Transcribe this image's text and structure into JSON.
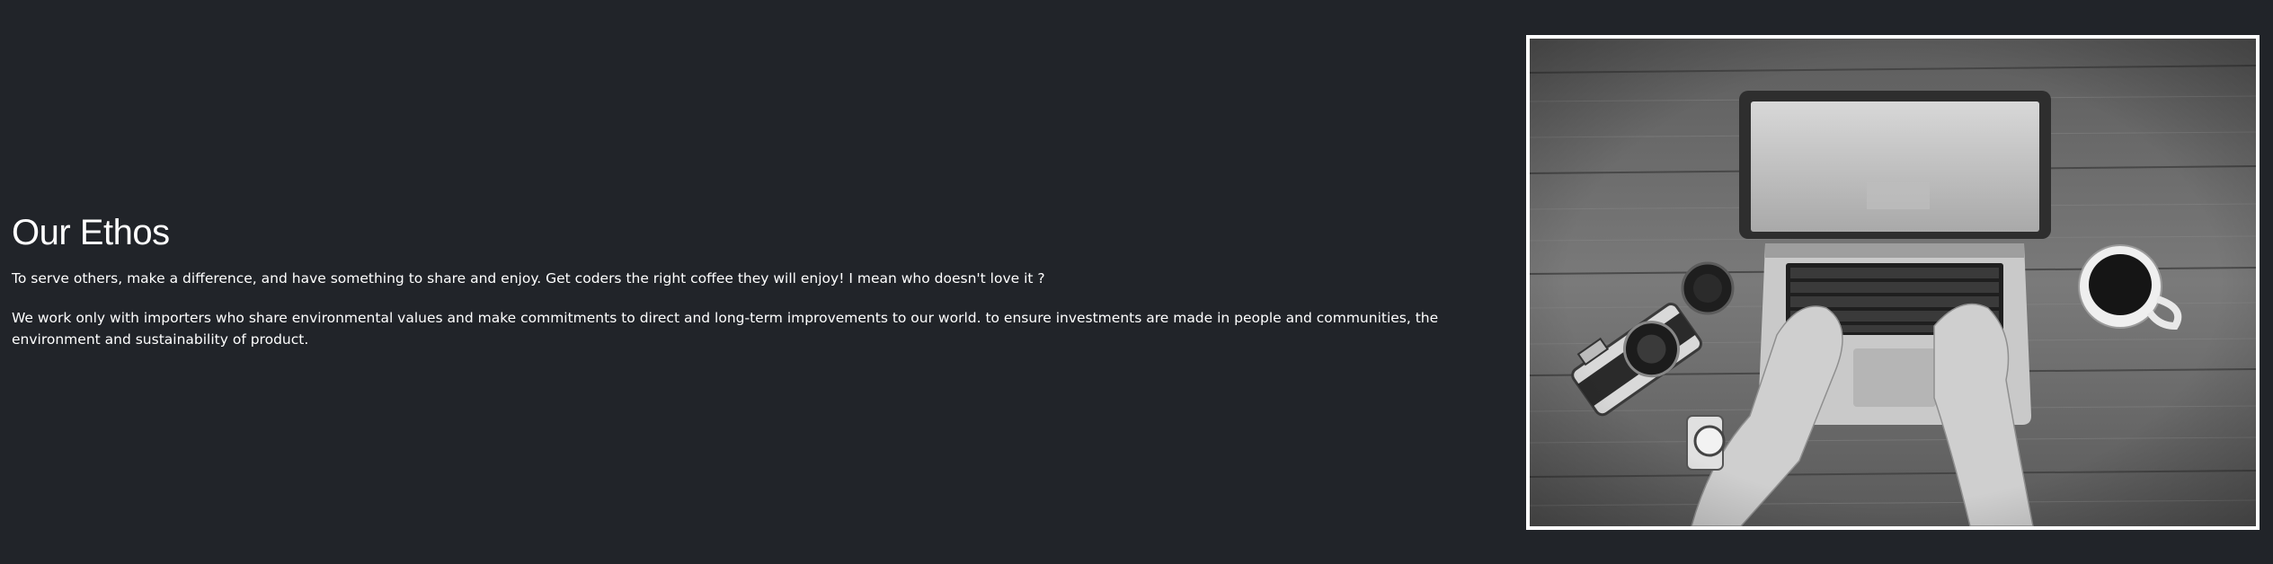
{
  "ethos": {
    "heading": "Our Ethos",
    "paragraphs": [
      "To serve others, make a difference, and have something to share and enjoy. Get coders the right coffee they will enjoy! I mean who doesn't love it ?",
      "We work only with importers who share environmental values and make commitments to direct and long-term improvements to our world. to ensure investments are made in people and communities, the environment and sustainability of product."
    ]
  },
  "colors": {
    "page_background": "#212429",
    "text": "#ffffff",
    "image_border": "#ffffff"
  }
}
